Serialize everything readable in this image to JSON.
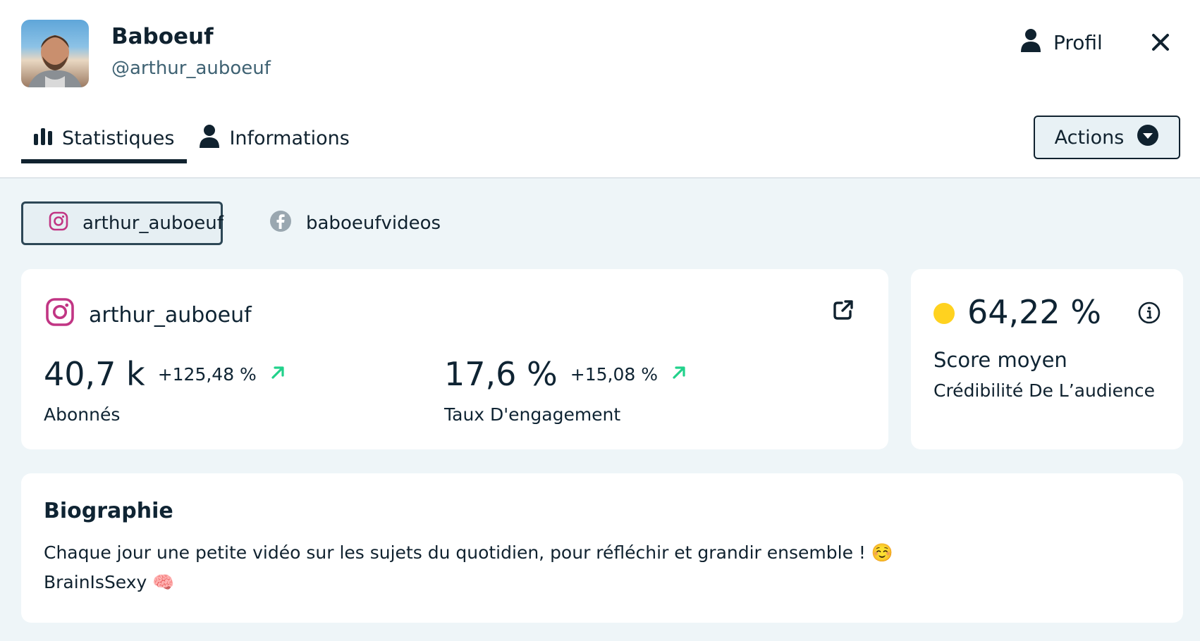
{
  "header": {
    "name": "Baboeuf",
    "handle": "@arthur_auboeuf",
    "profile_label": "Profil",
    "icons": {
      "profile": "user-icon",
      "close": "close-icon"
    }
  },
  "tabs": [
    {
      "label": "Statistiques",
      "icon": "bar-chart-icon",
      "active": true
    },
    {
      "label": "Informations",
      "icon": "user-icon",
      "active": false
    }
  ],
  "actions": {
    "label": "Actions"
  },
  "accounts": [
    {
      "label": "arthur_auboeuf",
      "platform": "instagram",
      "active": true
    },
    {
      "label": "baboeufvideos",
      "platform": "facebook",
      "active": false
    }
  ],
  "stats": {
    "account": "arthur_auboeuf",
    "followers": {
      "value": "40,7 k",
      "delta": "+125,48 %",
      "label": "Abonnés"
    },
    "engagement": {
      "value": "17,6 %",
      "delta": "+15,08 %",
      "label": "Taux D'engagement"
    }
  },
  "score": {
    "value": "64,22 %",
    "label": "Score moyen",
    "sublabel": "Crédibilité De L’audience"
  },
  "bio": {
    "title": "Biographie",
    "text": "Chaque jour une petite vidéo sur les sujets du quotidien, pour réfléchir et grandir ensemble ! ☺️\nBrainIsSexy 🧠"
  },
  "colors": {
    "primary": "#10222f",
    "background": "#eef5f8",
    "positive": "#21d18b",
    "score_dot": "#ffd21f",
    "instagram": "#c13584"
  }
}
